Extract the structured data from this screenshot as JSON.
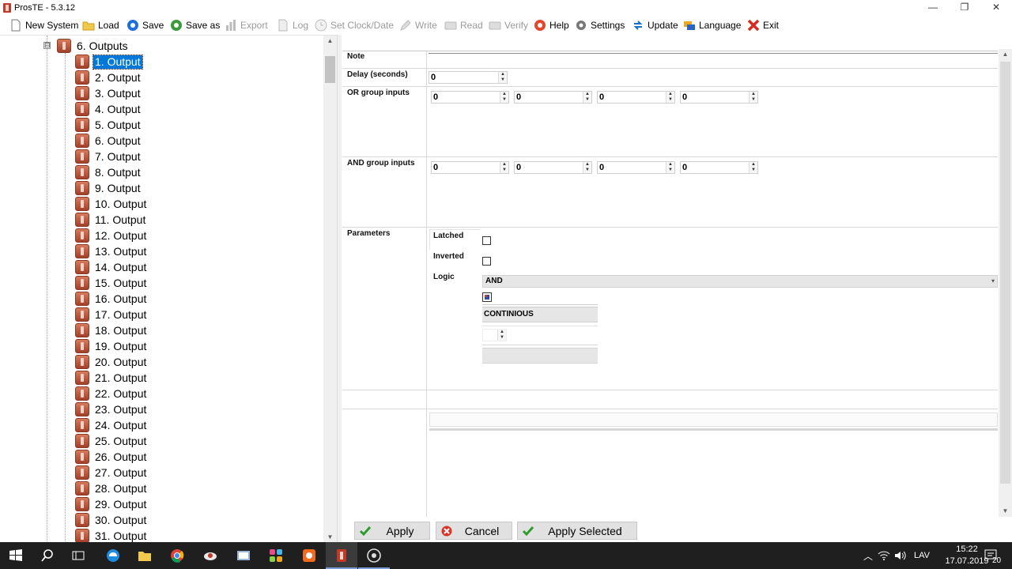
{
  "window": {
    "title": "ProsTE - 5.3.12"
  },
  "toolbar": {
    "items": [
      {
        "label": "New System",
        "icon": "new-file-icon",
        "enabled": true
      },
      {
        "label": "Load",
        "icon": "folder-icon",
        "enabled": true
      },
      {
        "label": "Save",
        "icon": "save-icon",
        "enabled": true
      },
      {
        "label": "Save as",
        "icon": "save-as-icon",
        "enabled": true
      },
      {
        "label": "Export",
        "icon": "export-icon",
        "enabled": false
      },
      {
        "label": "Log",
        "icon": "log-icon",
        "enabled": false
      },
      {
        "label": "Set Clock/Date",
        "icon": "clock-icon",
        "enabled": false
      },
      {
        "label": "Write",
        "icon": "pencil-icon",
        "enabled": false
      },
      {
        "label": "Read",
        "icon": "read-icon",
        "enabled": false
      },
      {
        "label": "Verify",
        "icon": "verify-icon",
        "enabled": false
      },
      {
        "label": "Help",
        "icon": "help-icon",
        "enabled": true
      },
      {
        "label": "Settings",
        "icon": "gear-icon",
        "enabled": true
      },
      {
        "label": "Update",
        "icon": "update-icon",
        "enabled": true
      },
      {
        "label": "Language",
        "icon": "language-icon",
        "enabled": true
      },
      {
        "label": "Exit",
        "icon": "exit-icon",
        "enabled": true
      }
    ]
  },
  "tree": {
    "parent": {
      "label": "6. Outputs",
      "expander": "⊟"
    },
    "items": [
      "1. Output",
      "2. Output",
      "3. Output",
      "4. Output",
      "5. Output",
      "6. Output",
      "7. Output",
      "8. Output",
      "9. Output",
      "10. Output",
      "11. Output",
      "12. Output",
      "13. Output",
      "14. Output",
      "15. Output",
      "16. Output",
      "17. Output",
      "18. Output",
      "19. Output",
      "20. Output",
      "21. Output",
      "22. Output",
      "23. Output",
      "24. Output",
      "25. Output",
      "26. Output",
      "27. Output",
      "28. Output",
      "29. Output",
      "30. Output",
      "31. Output"
    ],
    "selected_index": 0
  },
  "properties": {
    "note_label": "Note",
    "delay_label": "Delay (seconds)",
    "delay_value": "0",
    "or_label": "OR group inputs",
    "or_values": [
      "0",
      "0",
      "0",
      "0"
    ],
    "and_label": "AND group inputs",
    "and_values": [
      "0",
      "0",
      "0",
      "0"
    ],
    "parameters_label": "Parameters",
    "latched_label": "Latched",
    "latched_checked": false,
    "inverted_label": "Inverted",
    "inverted_checked": false,
    "logic_label": "Logic",
    "logic_value": "AND",
    "mode_value": "CONTINIOUS"
  },
  "buttons": {
    "apply": "Apply",
    "cancel": "Cancel",
    "apply_selected": "Apply Selected"
  },
  "taskbar": {
    "language": "LAV",
    "time": "15:22",
    "date": "17.07.2019",
    "notifications": "20"
  },
  "colors": {
    "selection": "#0078d7",
    "taskbar": "#1f1f1f",
    "apply_check": "#2e9b2e",
    "cancel_red": "#d9342b"
  }
}
